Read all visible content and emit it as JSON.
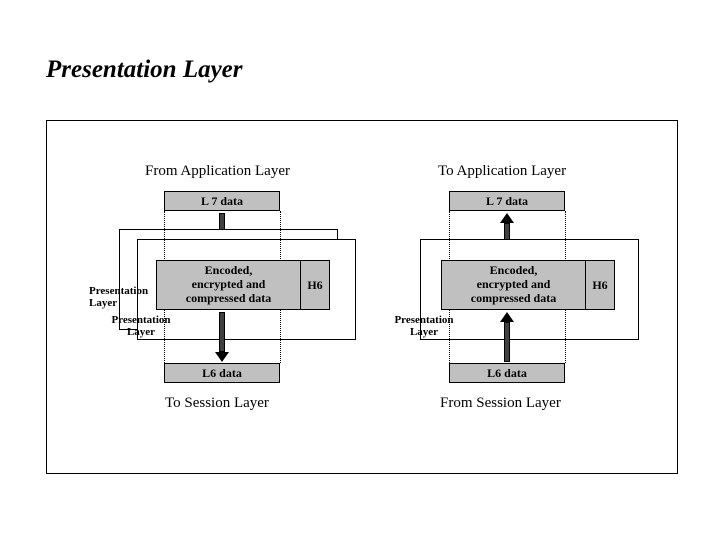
{
  "title": "Presentation Layer",
  "left": {
    "top_label": "From Application Layer",
    "l7": "L 7 data",
    "encoded": "Encoded,\nencrypted and\ncompressed data",
    "h6": "H6",
    "side_label1": "Presentation\nLayer",
    "side_label2": "Presentation\nLayer",
    "l6": "L6 data",
    "bottom_label": "To Session Layer"
  },
  "right": {
    "top_label": "To Application Layer",
    "l7": "L 7 data",
    "encoded": "Encoded,\nencrypted and\ncompressed data",
    "h6": "H6",
    "side_label": "Presentation\nLayer",
    "l6": "L6 data",
    "bottom_label": "From Session Layer"
  }
}
